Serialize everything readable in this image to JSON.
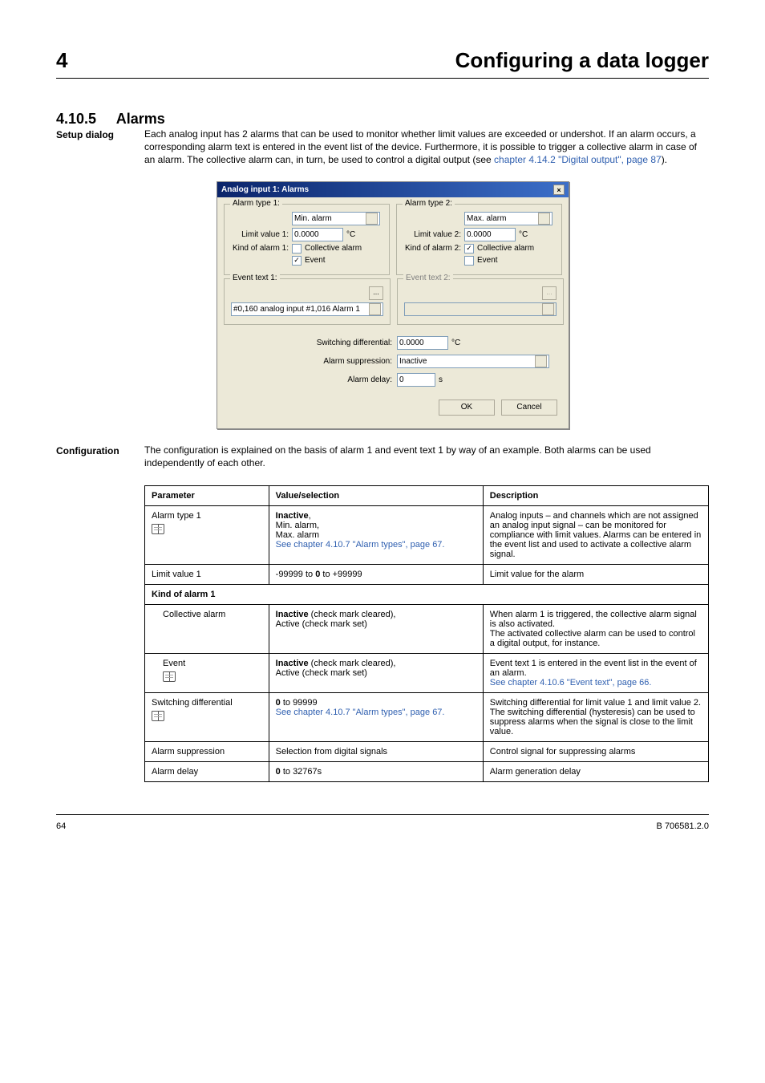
{
  "header": {
    "section_num": "4",
    "section_title": "Configuring a data logger"
  },
  "section": {
    "number": "4.10.5",
    "title": "Alarms",
    "label": "Setup dialog",
    "intro": "Each analog input has 2 alarms that can be used to monitor whether limit values are exceeded or undershot. If an alarm occurs, a corresponding alarm text is entered in the event list of the device. Furthermore, it is possible to trigger a collective alarm in case of an alarm. The collective alarm can, in turn, be used to control a digital output (see chapter 4.14.2 \"Digital output\", page 87).",
    "table_intro_label": "Configuration",
    "table_intro_text": "The configuration is explained on the basis of alarm 1 and event text 1 by way of an example. Both alarms can be used independently of each other."
  },
  "dialog": {
    "title": "Analog input 1: Alarms",
    "alarm1": {
      "legend": "Alarm type 1:",
      "type_value": "Min. alarm",
      "limit_label": "Limit value 1:",
      "limit_value": "0.0000",
      "limit_unit": "°C",
      "kind_label": "Kind of alarm 1:",
      "collective_label": "Collective alarm",
      "collective_checked": false,
      "event_label": "Event",
      "event_checked": true
    },
    "alarm2": {
      "legend": "Alarm type 2:",
      "type_value": "Max. alarm",
      "limit_label": "Limit value 2:",
      "limit_value": "0.0000",
      "limit_unit": "°C",
      "kind_label": "Kind of alarm 2:",
      "collective_label": "Collective alarm",
      "collective_checked": true,
      "event_label": "Event",
      "event_checked": false
    },
    "eventtext1": {
      "legend": "Event text 1:",
      "value": "#0,160 analog input #1,016 Alarm 1"
    },
    "eventtext2": {
      "legend": "Event text 2:",
      "value": ""
    },
    "switch_diff_label": "Switching differential:",
    "switch_diff_value": "0.0000",
    "switch_diff_unit": "°C",
    "supp_label": "Alarm suppression:",
    "supp_value": "Inactive",
    "delay_label": "Alarm delay:",
    "delay_value": "0",
    "delay_unit": "s",
    "ok": "OK",
    "cancel": "Cancel"
  },
  "table": {
    "h1": "Parameter",
    "h2": "Value/selection",
    "h3": "Description",
    "rows": [
      {
        "p": "Alarm type 1",
        "icon": true,
        "v": "Inactive,\nMin. alarm,\nMax. alarm\nSee chapter 4.10.7 \"Alarm types\", page 67.",
        "d": "Analog inputs – and channels which are not assigned an analog input signal – can be monitored for compliance with limit values. Alarms can be entered in the event list and used to activate a collective alarm signal."
      },
      {
        "p": "Limit value 1",
        "v": "-99999 to 0 to +99999",
        "d": "Limit value for the alarm"
      },
      {
        "subhead": "Kind of alarm 1"
      },
      {
        "p": "Collective alarm",
        "v": "Inactive (check mark cleared),\nActive (check mark set)",
        "d": "When alarm 1 is triggered, the collective alarm signal is also activated.\nThe activated collective alarm can be used to control a digital output, for instance."
      },
      {
        "p": "Event",
        "icon": true,
        "v": "Inactive (check mark cleared),\nActive (check mark set)",
        "d": "Event text 1 is entered in the event list in the event of an alarm.\nSee chapter 4.10.6 \"Event text\", page 66."
      },
      {
        "p": "Switching differential",
        "icon": true,
        "v": "0 to 99999\nSee chapter 4.10.7 \"Alarm types\", page 67.",
        "d": "Switching differential for limit value 1 and limit value 2. The switching differential (hysteresis) can be used to suppress alarms when the signal is close to the limit value."
      },
      {
        "p": "Alarm suppression",
        "v": "Selection from digital signals",
        "d": "Control signal for suppressing alarms"
      },
      {
        "p": "Alarm delay",
        "v": "0 to 32767s",
        "d": "Alarm generation delay"
      }
    ]
  },
  "footer": {
    "page": "64",
    "doc": "B 706581.2.0"
  },
  "links": {
    "digital_output": "See chapter 4.14.2 \"Digital output\", page 87",
    "alarm_types": "See chapter 4.10.7 \"Alarm types\", page 67.",
    "event_text": "See chapter 4.10.6 \"Event text\", page 66."
  }
}
